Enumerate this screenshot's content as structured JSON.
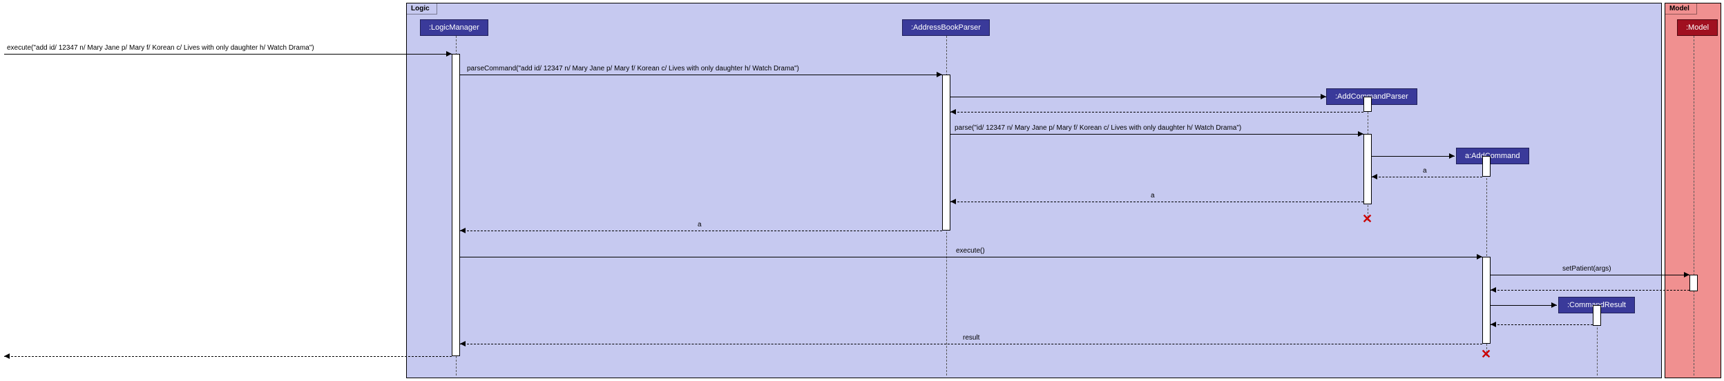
{
  "frames": {
    "logic": {
      "label": "Logic"
    },
    "model": {
      "label": "Model"
    }
  },
  "participants": {
    "logicManager": ":LogicManager",
    "addressBookParser": ":AddressBookParser",
    "addCommandParser": ":AddCommandParser",
    "addCommand": "a:AddCommand",
    "commandResult": ":CommandResult",
    "model": ":Model"
  },
  "messages": {
    "m1": "execute(\"add id/ 12347 n/ Mary Jane p/ Mary f/ Korean c/ Lives with only daughter h/ Watch Drama\")",
    "m2": "parseCommand(\"add id/ 12347 n/ Mary Jane p/ Mary f/ Korean c/ Lives with only daughter h/ Watch Drama\")",
    "m3": "parse(\"id/ 12347 n/ Mary Jane p/ Mary f/ Korean c/ Lives with only daughter h/ Watch Drama\")",
    "r1": "a",
    "r2": "a",
    "r3": "a",
    "m4": "execute()",
    "m5": "setPatient(args)",
    "r4": "result"
  },
  "chart_data": {
    "type": "sequence-diagram",
    "frames": [
      {
        "name": "Logic",
        "contains": [
          "LogicManager",
          "AddressBookParser",
          "AddCommandParser",
          "AddCommand",
          "CommandResult"
        ]
      },
      {
        "name": "Model",
        "contains": [
          "Model"
        ]
      }
    ],
    "lifelines": [
      {
        "id": "caller",
        "name": "",
        "preexisting": true
      },
      {
        "id": "LogicManager",
        "name": ":LogicManager",
        "preexisting": true
      },
      {
        "id": "AddressBookParser",
        "name": ":AddressBookParser",
        "preexisting": true
      },
      {
        "id": "AddCommandParser",
        "name": ":AddCommandParser",
        "preexisting": false,
        "destroyed": true
      },
      {
        "id": "AddCommand",
        "name": "a:AddCommand",
        "preexisting": false,
        "destroyed": true
      },
      {
        "id": "CommandResult",
        "name": ":CommandResult",
        "preexisting": false
      },
      {
        "id": "Model",
        "name": ":Model",
        "preexisting": true
      }
    ],
    "messages": [
      {
        "from": "caller",
        "to": "LogicManager",
        "label": "execute(\"add id/ 12347 n/ Mary Jane p/ Mary f/ Korean c/ Lives with only daughter h/ Watch Drama\")",
        "type": "sync"
      },
      {
        "from": "LogicManager",
        "to": "AddressBookParser",
        "label": "parseCommand(\"add id/ 12347 n/ Mary Jane p/ Mary f/ Korean c/ Lives with only daughter h/ Watch Drama\")",
        "type": "sync"
      },
      {
        "from": "AddressBookParser",
        "to": "AddCommandParser",
        "label": "",
        "type": "create"
      },
      {
        "from": "AddCommandParser",
        "to": "AddressBookParser",
        "label": "",
        "type": "return"
      },
      {
        "from": "AddressBookParser",
        "to": "AddCommandParser",
        "label": "parse(\"id/ 12347 n/ Mary Jane p/ Mary f/ Korean c/ Lives with only daughter h/ Watch Drama\")",
        "type": "sync"
      },
      {
        "from": "AddCommandParser",
        "to": "AddCommand",
        "label": "",
        "type": "create"
      },
      {
        "from": "AddCommand",
        "to": "AddCommandParser",
        "label": "a",
        "type": "return"
      },
      {
        "from": "AddCommandParser",
        "to": "AddressBookParser",
        "label": "a",
        "type": "return"
      },
      {
        "from": "AddCommandParser",
        "to": null,
        "label": "",
        "type": "destroy"
      },
      {
        "from": "AddressBookParser",
        "to": "LogicManager",
        "label": "a",
        "type": "return"
      },
      {
        "from": "LogicManager",
        "to": "AddCommand",
        "label": "execute()",
        "type": "sync"
      },
      {
        "from": "AddCommand",
        "to": "Model",
        "label": "setPatient(args)",
        "type": "sync"
      },
      {
        "from": "Model",
        "to": "AddCommand",
        "label": "",
        "type": "return"
      },
      {
        "from": "AddCommand",
        "to": "CommandResult",
        "label": "",
        "type": "create"
      },
      {
        "from": "CommandResult",
        "to": "AddCommand",
        "label": "",
        "type": "return"
      },
      {
        "from": "AddCommand",
        "to": "LogicManager",
        "label": "result",
        "type": "return"
      },
      {
        "from": "AddCommand",
        "to": null,
        "label": "",
        "type": "destroy"
      },
      {
        "from": "LogicManager",
        "to": "caller",
        "label": "",
        "type": "return"
      }
    ]
  }
}
